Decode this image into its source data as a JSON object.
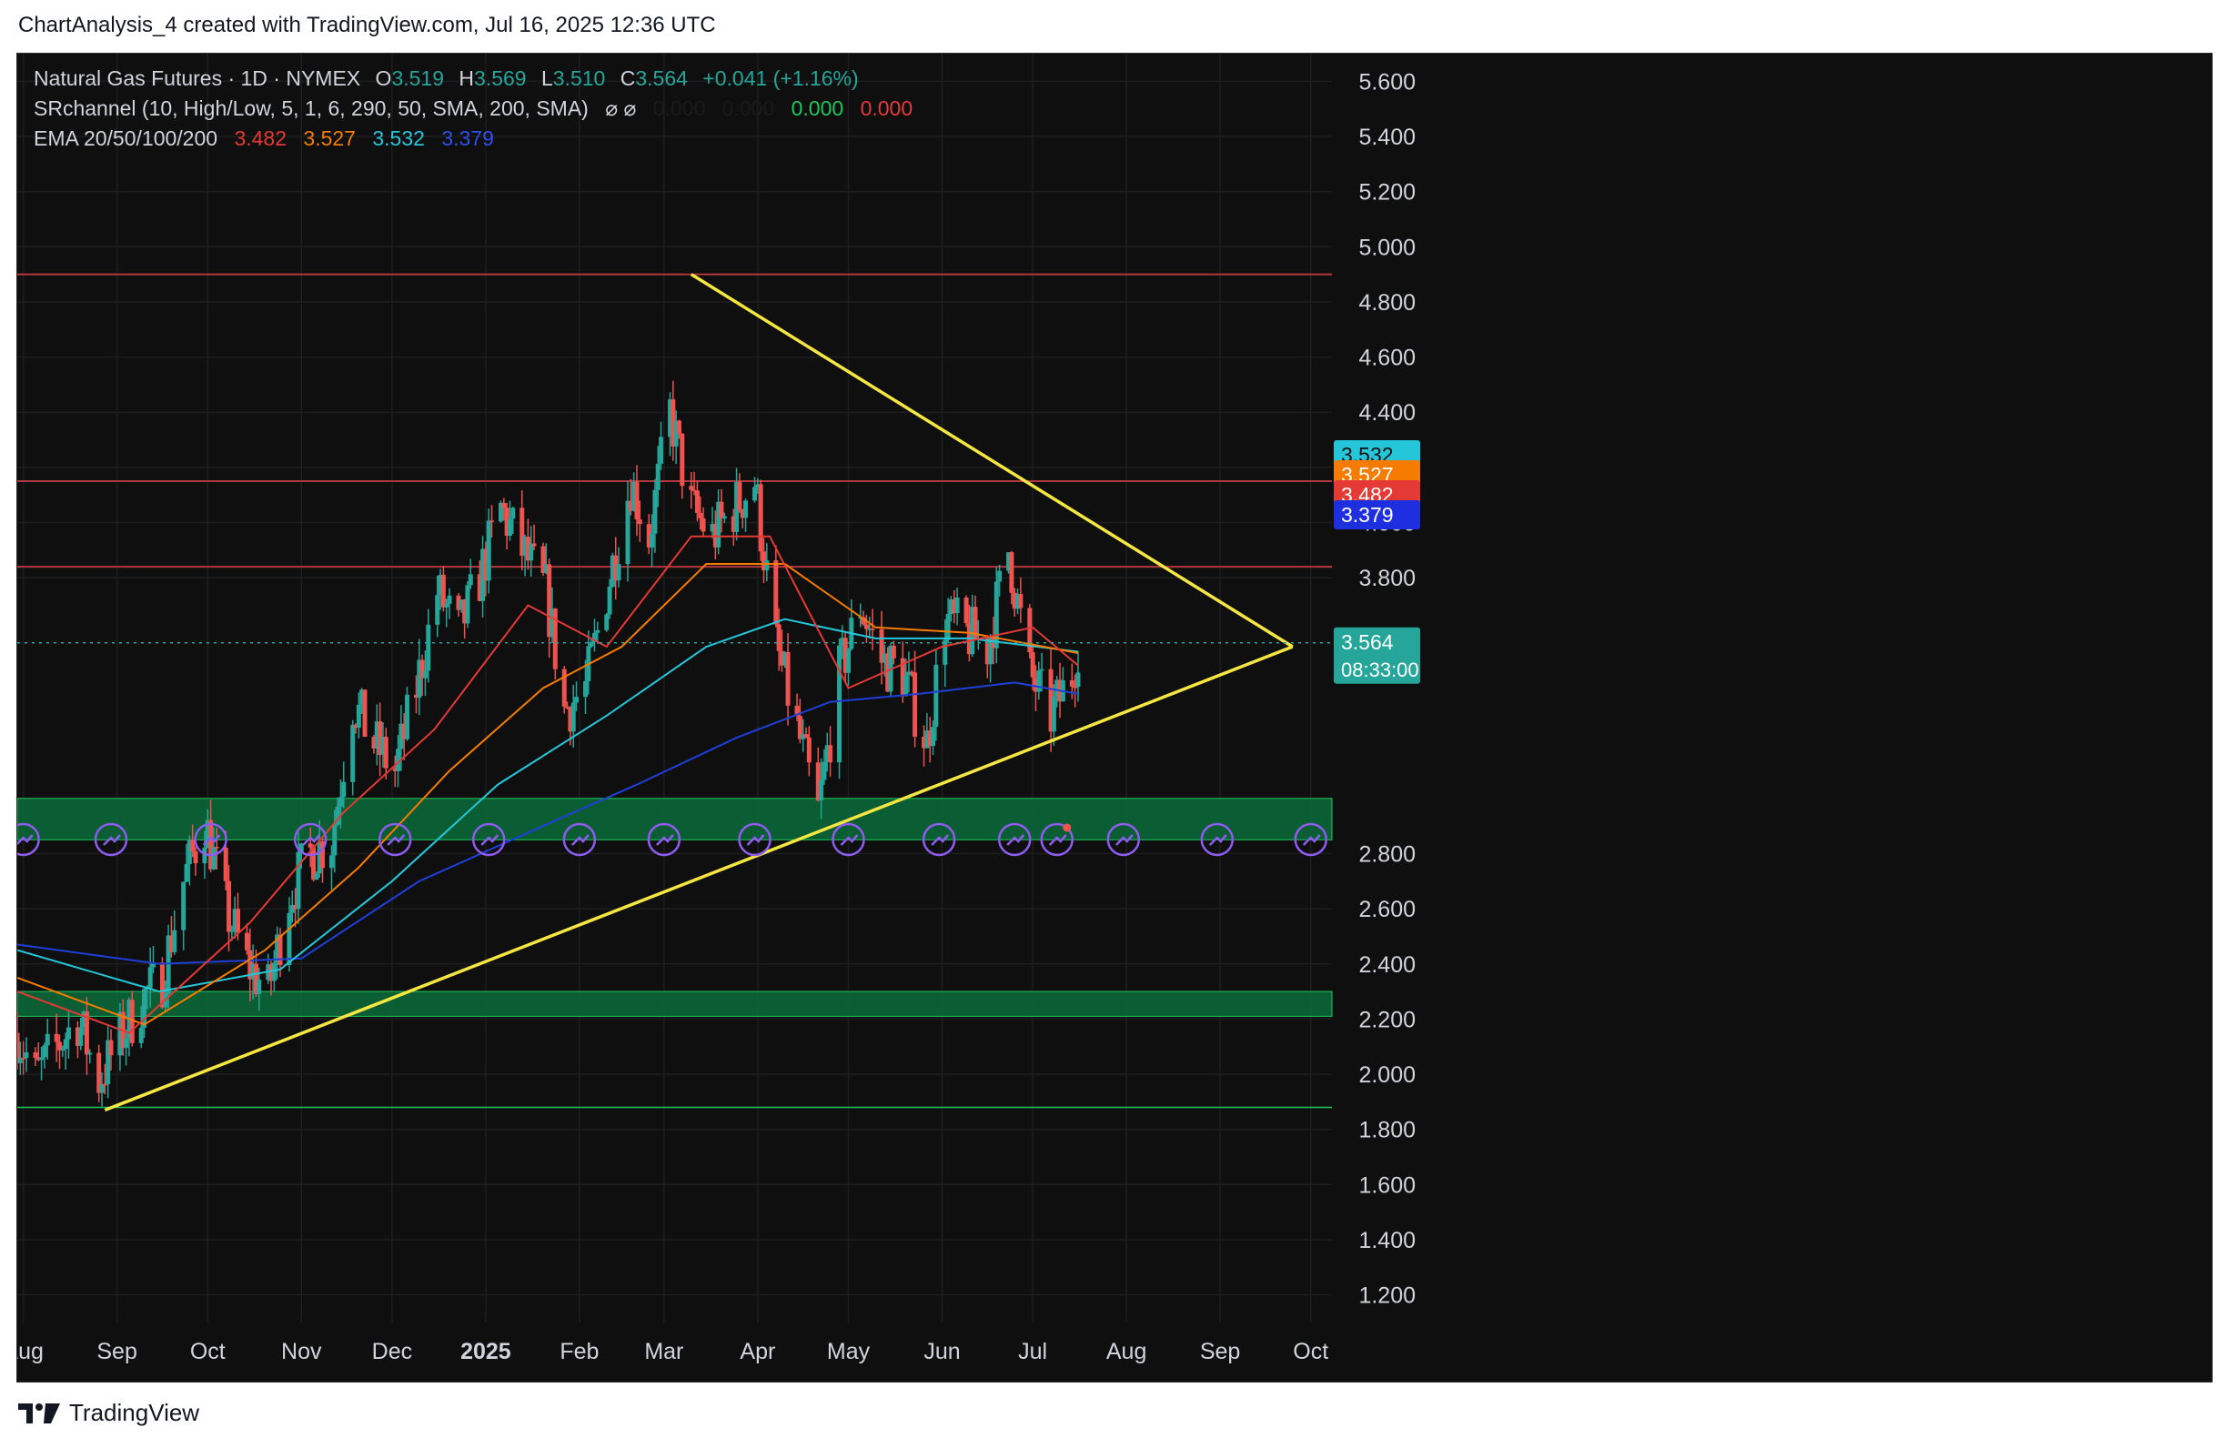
{
  "caption": "ChartAnalysis_4 created with TradingView.com, Jul 16, 2025 12:36 UTC",
  "brand": "TradingView",
  "colors": {
    "background": "#0f0f0f",
    "up": "#26a69a",
    "down": "#ef5350",
    "ema20": "#e53935",
    "ema50": "#f57c00",
    "ema100": "#26c6da",
    "ema200": "#1e3fd8",
    "trendline": "#f5e642",
    "zone": "#0b6b3a",
    "resistance": "#b2373f",
    "event": "#8e5cf0"
  },
  "legend": {
    "line1": {
      "title": "Natural Gas Futures · 1D · NYMEX",
      "o_label": "O",
      "o_value": "3.519",
      "h_label": "H",
      "h_value": "3.569",
      "l_label": "L",
      "l_value": "3.510",
      "c_label": "C",
      "c_value": "3.564",
      "change": "+0.041 (+1.16%)"
    },
    "line2": {
      "title": "SRchannel (10, High/Low, 5, 1, 6, 290, 50, SMA, 200, SMA)",
      "symbols": "⌀  ⌀",
      "v1": "0.000",
      "v2": "0.000",
      "v3": "0.000",
      "v4": "0.000"
    },
    "line3": {
      "title": "EMA 20/50/100/200",
      "v20": "3.482",
      "v50": "3.527",
      "v100": "3.532",
      "v200": "3.379"
    }
  },
  "price_tags": {
    "last": "3.564",
    "countdown": "08:33:00",
    "ema100": "3.532",
    "ema50": "3.527",
    "ema20": "3.482",
    "ema200": "3.379"
  },
  "chart_data": {
    "type": "candlestick",
    "x_labels": [
      "Aug",
      "Sep",
      "Oct",
      "Nov",
      "Dec",
      "2025",
      "Feb",
      "Mar",
      "Apr",
      "May",
      "Jun",
      "Jul",
      "Aug",
      "Sep",
      "Oct"
    ],
    "x_label_bold": "2025",
    "y_ticks": [
      "5.600",
      "5.400",
      "5.200",
      "5.000",
      "4.800",
      "4.600",
      "4.400",
      "4.200",
      "4.000",
      "3.800",
      "2.800",
      "2.600",
      "2.400",
      "2.200",
      "2.000",
      "1.800",
      "1.600",
      "1.400",
      "1.200"
    ],
    "ylim": [
      1.1,
      5.7
    ],
    "x_range": [
      "2024-07-30",
      "2025-10-08"
    ],
    "grid": true,
    "series_close": {
      "dates": [
        "2024-07-30",
        "2024-08-05",
        "2024-08-12",
        "2024-08-19",
        "2024-08-26",
        "2024-09-03",
        "2024-09-10",
        "2024-09-16",
        "2024-09-23",
        "2024-09-30",
        "2024-10-07",
        "2024-10-14",
        "2024-10-21",
        "2024-10-28",
        "2024-11-04",
        "2024-11-11",
        "2024-11-18",
        "2024-11-25",
        "2024-12-02",
        "2024-12-09",
        "2024-12-16",
        "2024-12-23",
        "2024-12-30",
        "2025-01-06",
        "2025-01-13",
        "2025-01-21",
        "2025-01-27",
        "2025-02-03",
        "2025-02-10",
        "2025-02-18",
        "2025-02-24",
        "2025-03-03",
        "2025-03-10",
        "2025-03-17",
        "2025-03-24",
        "2025-03-31",
        "2025-04-07",
        "2025-04-14",
        "2025-04-21",
        "2025-04-28",
        "2025-05-05",
        "2025-05-12",
        "2025-05-19",
        "2025-05-27",
        "2025-06-02",
        "2025-06-09",
        "2025-06-16",
        "2025-06-23",
        "2025-06-30",
        "2025-07-07",
        "2025-07-14",
        "2025-07-16"
      ],
      "close": [
        2.15,
        1.99,
        2.1,
        2.2,
        1.98,
        2.15,
        2.28,
        2.35,
        2.7,
        2.92,
        2.6,
        2.4,
        2.3,
        2.65,
        2.8,
        2.85,
        3.35,
        3.2,
        3.1,
        3.4,
        3.75,
        3.6,
        3.8,
        4.05,
        3.9,
        3.75,
        3.32,
        3.4,
        3.75,
        4.15,
        3.95,
        4.4,
        4.05,
        3.95,
        4.05,
        4.15,
        3.55,
        3.25,
        2.95,
        3.45,
        3.7,
        3.5,
        3.45,
        3.2,
        3.65,
        3.6,
        3.55,
        3.9,
        3.45,
        3.3,
        3.45,
        3.564
      ]
    },
    "ema": {
      "ema20": {
        "dates": [
          "2024-07-30",
          "2024-09-05",
          "2024-10-15",
          "2024-11-15",
          "2024-12-15",
          "2025-01-15",
          "2025-02-10",
          "2025-03-10",
          "2025-04-05",
          "2025-05-01",
          "2025-06-01",
          "2025-07-01",
          "2025-07-16"
        ],
        "values": [
          2.3,
          2.15,
          2.55,
          2.95,
          3.25,
          3.7,
          3.55,
          3.95,
          3.95,
          3.4,
          3.55,
          3.62,
          3.482
        ]
      },
      "ema50": {
        "dates": [
          "2024-07-30",
          "2024-09-10",
          "2024-10-20",
          "2024-11-20",
          "2024-12-20",
          "2025-01-20",
          "2025-02-15",
          "2025-03-15",
          "2025-04-10",
          "2025-05-10",
          "2025-06-10",
          "2025-07-16"
        ],
        "values": [
          2.35,
          2.18,
          2.45,
          2.75,
          3.1,
          3.4,
          3.55,
          3.85,
          3.85,
          3.62,
          3.6,
          3.527
        ]
      },
      "ema100": {
        "dates": [
          "2024-07-30",
          "2024-09-15",
          "2024-10-25",
          "2024-12-01",
          "2025-01-05",
          "2025-02-10",
          "2025-03-15",
          "2025-04-10",
          "2025-05-10",
          "2025-06-10",
          "2025-07-16"
        ],
        "values": [
          2.45,
          2.3,
          2.38,
          2.7,
          3.05,
          3.3,
          3.55,
          3.65,
          3.58,
          3.58,
          3.532
        ]
      },
      "ema200": {
        "dates": [
          "2024-07-30",
          "2024-09-15",
          "2024-11-01",
          "2024-12-10",
          "2025-01-20",
          "2025-02-20",
          "2025-03-25",
          "2025-04-25",
          "2025-05-25",
          "2025-06-25",
          "2025-07-16"
        ],
        "values": [
          2.47,
          2.4,
          2.42,
          2.7,
          2.9,
          3.05,
          3.22,
          3.35,
          3.38,
          3.42,
          3.379
        ]
      }
    },
    "support_zones": [
      [
        2.85,
        3.0
      ],
      [
        2.21,
        2.3
      ]
    ],
    "resistance_lines": [
      4.9,
      4.15,
      3.84
    ],
    "support_line": 1.88,
    "triangle": {
      "upper": {
        "from": [
          "2025-03-10",
          4.9
        ],
        "to": [
          "2025-09-25",
          3.55
        ]
      },
      "lower": {
        "from": [
          "2024-08-28",
          1.87
        ],
        "to": [
          "2025-09-25",
          3.55
        ]
      }
    },
    "event_marker_dates": [
      "2024-08-01",
      "2024-08-30",
      "2024-10-02",
      "2024-11-04",
      "2024-12-02",
      "2025-01-02",
      "2025-02-01",
      "2025-03-01",
      "2025-03-31",
      "2025-05-01",
      "2025-05-31",
      "2025-06-25",
      "2025-07-09",
      "2025-07-31",
      "2025-08-31",
      "2025-10-01"
    ],
    "event_marker_alert_index": 12
  }
}
